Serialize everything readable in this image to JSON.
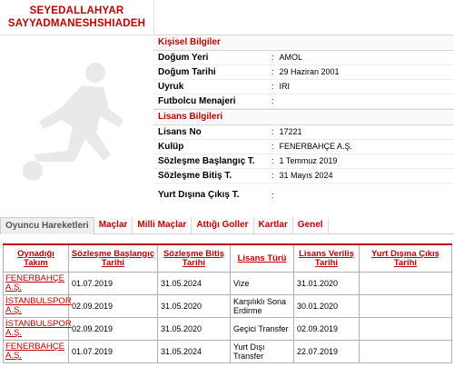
{
  "player": {
    "name_line1": "SEYEDALLAHYAR",
    "name_line2": "SAYYADMANESHSHIADEH"
  },
  "personal": {
    "section_title": "Kişisel Bilgiler",
    "fields": [
      {
        "label": "Doğum Yeri",
        "value": "AMOL"
      },
      {
        "label": "Doğum Tarihi",
        "value": "29 Haziran 2001"
      },
      {
        "label": "Uyruk",
        "value": "IRI"
      },
      {
        "label": "Futbolcu Menajeri",
        "value": ""
      }
    ]
  },
  "license": {
    "section_title": "Lisans Bilgileri",
    "fields": [
      {
        "label": "Lisans No",
        "value": "17221"
      },
      {
        "label": "Kulüp",
        "value": "FENERBAHÇE A.Ş."
      },
      {
        "label": "Sözleşme Başlangıç T.",
        "value": "1 Temmuz 2019"
      },
      {
        "label": "Sözleşme Bitiş T.",
        "value": "31 Mayıs 2024"
      },
      {
        "label": "Yurt Dışına Çıkış T.",
        "value": ""
      }
    ]
  },
  "tabs": [
    "Oyuncu Hareketleri",
    "Maçlar",
    "Milli Maçlar",
    "Attığı Goller",
    "Kartlar",
    "Genel"
  ],
  "table": {
    "headers": [
      "Oynadığı Takım",
      "Sözleşme Başlangıç Tarihi",
      "Sözleşme Bitiş Tarihi",
      "Lisans Türü",
      "Lisans Veriliş Tarihi",
      "Yurt Dışına Çıkış Tarihi"
    ],
    "rows": [
      {
        "club": "FENERBAHÇE A.Ş.",
        "start": "01.07.2019",
        "end": "31.05.2024",
        "type": "Vize",
        "issued": "31.01.2020",
        "abroad": ""
      },
      {
        "club": "İSTANBULSPOR A.Ş.",
        "start": "02.09.2019",
        "end": "31.05.2020",
        "type": "Karşılıklı Sona Erdirme",
        "issued": "30.01.2020",
        "abroad": ""
      },
      {
        "club": "İSTANBULSPOR A.Ş.",
        "start": "02.09.2019",
        "end": "31.05.2020",
        "type": "Geçici Transfer",
        "issued": "02.09.2019",
        "abroad": ""
      },
      {
        "club": "FENERBAHÇE A.Ş.",
        "start": "01.07.2019",
        "end": "31.05.2024",
        "type": "Yurt Dışı Transfer",
        "issued": "22.07.2019",
        "abroad": ""
      }
    ]
  },
  "colors": {
    "accent": "#c00000",
    "silhouette": "#e9e9e9"
  },
  "icons": {
    "photo": "player-silhouette-icon"
  }
}
